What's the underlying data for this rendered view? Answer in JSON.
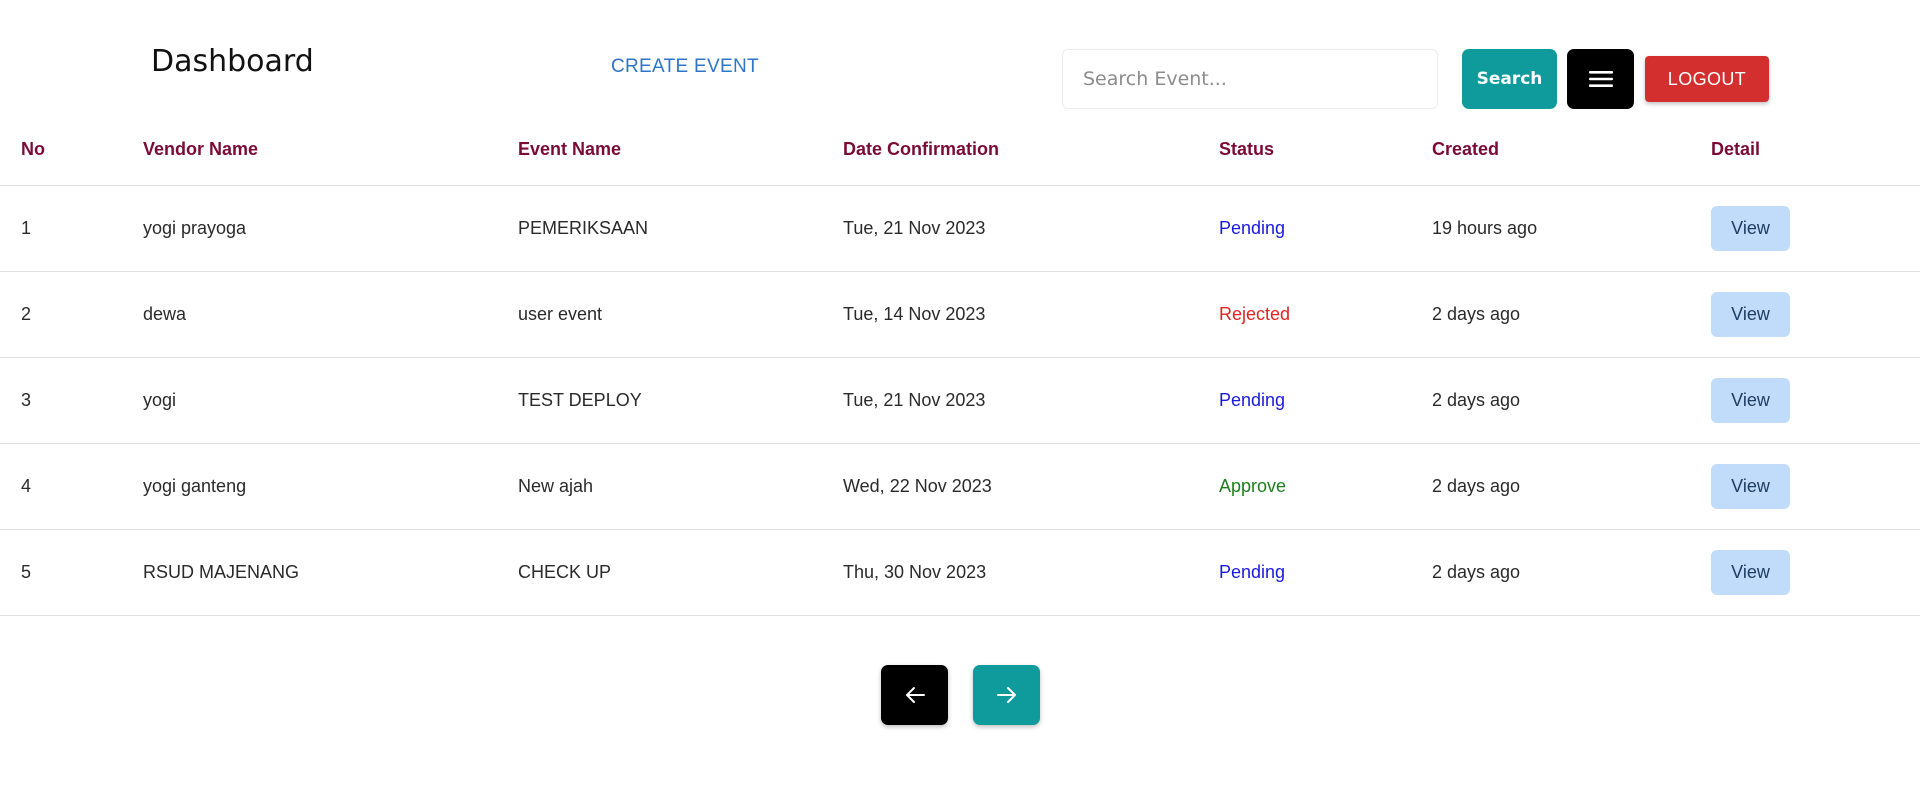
{
  "header": {
    "title": "Dashboard",
    "create_event": "CREATE EVENT",
    "search_placeholder": "Search Event...",
    "search_label": "Search",
    "menu_icon": "hamburger-menu-icon",
    "logout_label": "LOGOUT"
  },
  "table": {
    "columns": [
      "No",
      "Vendor Name",
      "Event Name",
      "Date Confirmation",
      "Status",
      "Created",
      "Detail"
    ],
    "rows": [
      {
        "no": "1",
        "vendor": "yogi prayoga",
        "event": "PEMERIKSAAN",
        "date": "Tue, 21 Nov 2023",
        "status": "Pending",
        "created": "19 hours ago",
        "detail": "View"
      },
      {
        "no": "2",
        "vendor": "dewa",
        "event": "user event",
        "date": "Tue, 14 Nov 2023",
        "status": "Rejected",
        "created": "2 days ago",
        "detail": "View"
      },
      {
        "no": "3",
        "vendor": "yogi",
        "event": "TEST DEPLOY",
        "date": "Tue, 21 Nov 2023",
        "status": "Pending",
        "created": "2 days ago",
        "detail": "View"
      },
      {
        "no": "4",
        "vendor": "yogi ganteng",
        "event": "New ajah",
        "date": "Wed, 22 Nov 2023",
        "status": "Approve",
        "created": "2 days ago",
        "detail": "View"
      },
      {
        "no": "5",
        "vendor": "RSUD MAJENANG",
        "event": "CHECK UP",
        "date": "Thu, 30 Nov 2023",
        "status": "Pending",
        "created": "2 days ago",
        "detail": "View"
      }
    ]
  },
  "status_colors": {
    "Pending": "#1a1adb",
    "Rejected": "#e02424",
    "Approve": "#1e7e1e"
  },
  "pagination": {
    "prev_icon": "arrow-left-icon",
    "next_icon": "arrow-right-icon"
  },
  "colors": {
    "accent": "#0f9b9c",
    "header_text": "#7a0b36",
    "logout": "#d32f2f",
    "view_button": "#c0dcfa"
  }
}
